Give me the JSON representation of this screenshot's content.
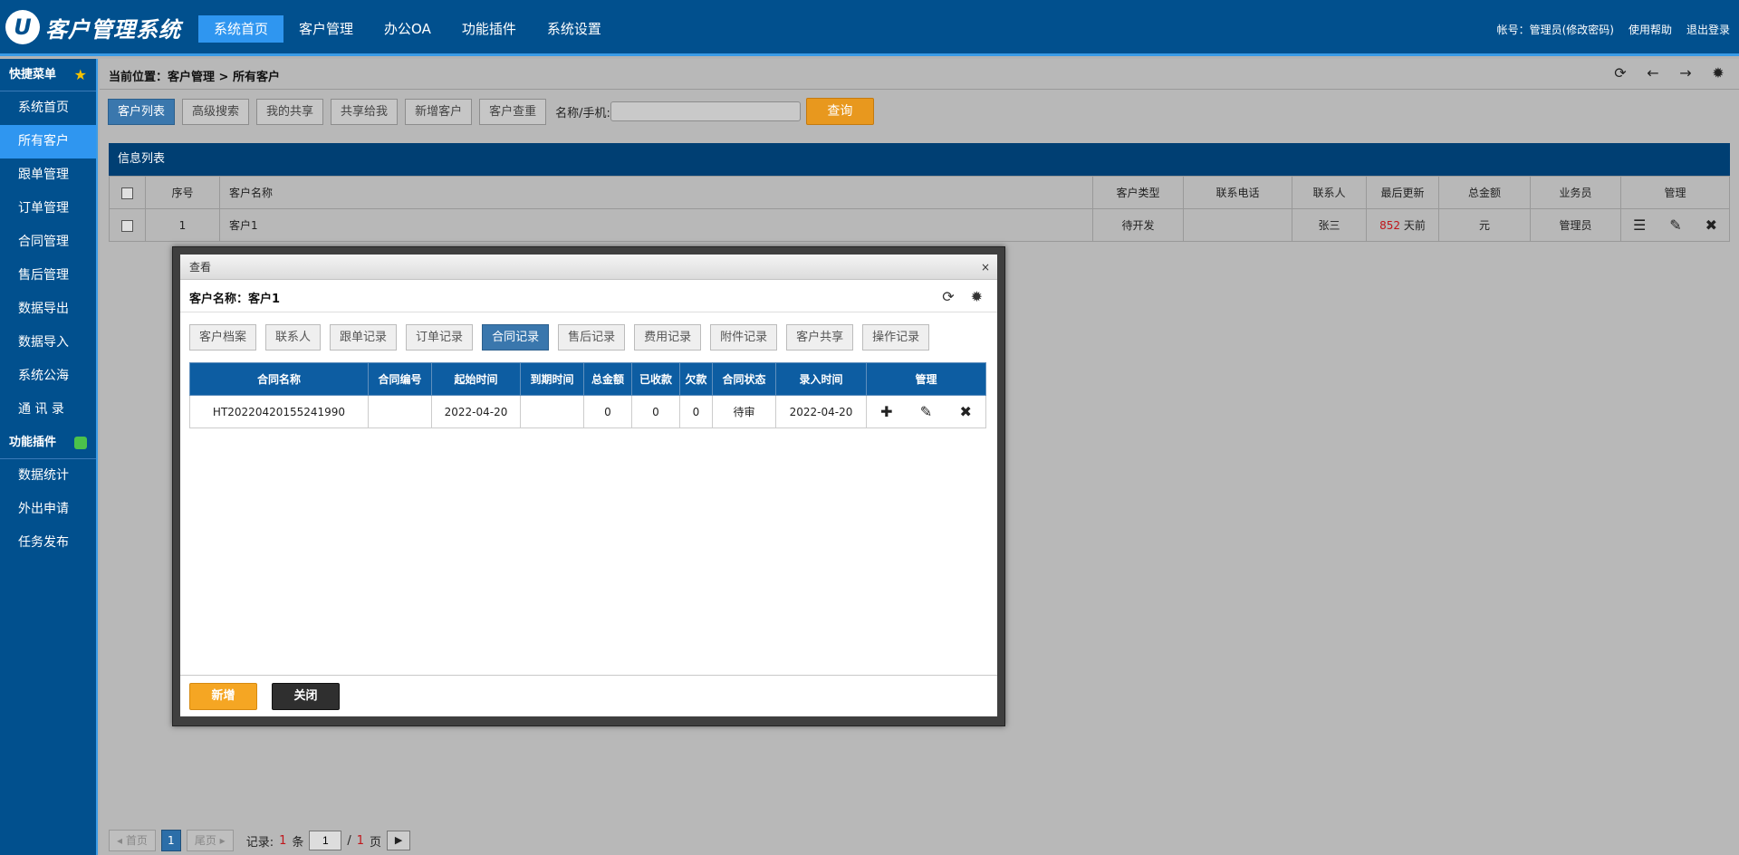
{
  "app": {
    "logo_mark": "U",
    "title": "客户管理系统"
  },
  "topnav": [
    {
      "label": "系统首页",
      "active": true
    },
    {
      "label": "客户管理",
      "active": false
    },
    {
      "label": "办公OA",
      "active": false
    },
    {
      "label": "功能插件",
      "active": false
    },
    {
      "label": "系统设置",
      "active": false
    }
  ],
  "topright": {
    "account": "帐号：管理员(修改密码)",
    "help": "使用帮助",
    "logout": "退出登录"
  },
  "sidebar": {
    "quick_title": "快捷菜单",
    "quick_items": [
      "系统首页",
      "所有客户",
      "跟单管理",
      "订单管理",
      "合同管理",
      "售后管理",
      "数据导出",
      "数据导入",
      "系统公海",
      "通 讯 录"
    ],
    "active_index": 1,
    "plugin_title": "功能插件",
    "plugin_items": [
      "数据统计",
      "外出申请",
      "任务发布"
    ]
  },
  "breadcrumb": {
    "prefix": "当前位置：",
    "path": "客户管理 > 所有客户"
  },
  "toolbar": {
    "buttons": [
      "客户列表",
      "高级搜索",
      "我的共享",
      "共享给我",
      "新增客户",
      "客户查重"
    ],
    "search_label": "名称/手机:",
    "search_value": "",
    "query_label": "查询"
  },
  "info_list_title": "信息列表",
  "list_table": {
    "headers": [
      "序号",
      "客户名称",
      "客户类型",
      "联系电话",
      "联系人",
      "最后更新",
      "总金额",
      "业务员",
      "管理"
    ],
    "rows": [
      {
        "index": "1",
        "name": "客户1",
        "type": "待开发",
        "phone": "",
        "contact": "张三",
        "updated_days": "852",
        "updated_suffix": " 天前",
        "amount": "元",
        "salesman": "管理员"
      }
    ]
  },
  "pager": {
    "first": "◂ 首页",
    "last": "尾页 ▸",
    "current": "1",
    "records_label": "记录:",
    "records_count": "1",
    "records_unit": "条",
    "page_input": "1",
    "page_sep": "/",
    "page_total": "1",
    "page_unit": "页",
    "next": "▶"
  },
  "modal": {
    "title": "查看",
    "close": "×",
    "customer_label": "客户名称：客户1",
    "tabs": [
      "客户档案",
      "联系人",
      "跟单记录",
      "订单记录",
      "合同记录",
      "售后记录",
      "费用记录",
      "附件记录",
      "客户共享",
      "操作记录"
    ],
    "active_tab": 4,
    "table_headers": [
      "合同名称",
      "合同编号",
      "起始时间",
      "到期时间",
      "总金额",
      "已收款",
      "欠款",
      "合同状态",
      "录入时间",
      "管理"
    ],
    "rows": [
      {
        "name": "HT20220420155241990",
        "code": "",
        "start": "2022-04-20",
        "end": "",
        "total": "0",
        "received": "0",
        "owed": "0",
        "status": "待审",
        "created": "2022-04-20"
      }
    ],
    "new_label": "新增",
    "close_label": "关闭"
  }
}
